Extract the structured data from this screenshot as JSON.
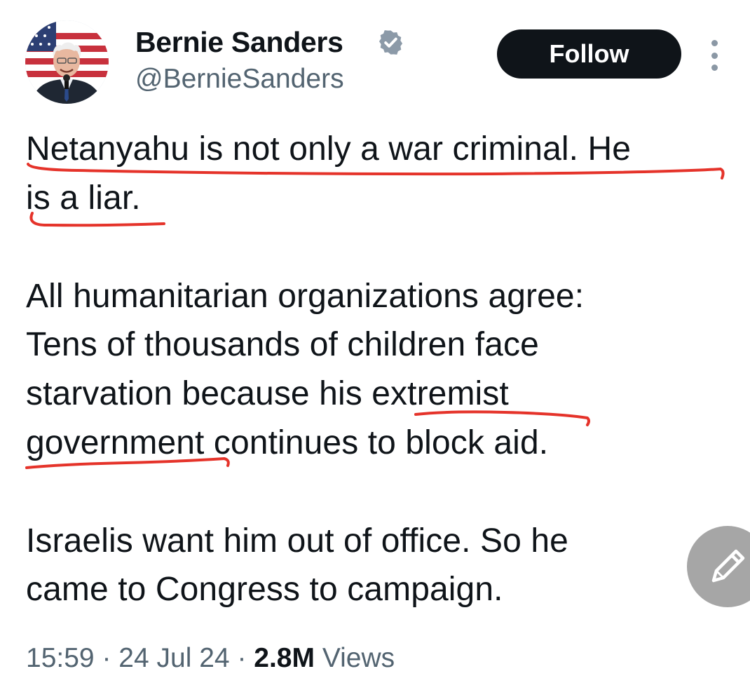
{
  "author": {
    "name": "Bernie Sanders",
    "handle": "@BernieSanders",
    "verified": true,
    "avatar_icon": "avatar-photo"
  },
  "actions": {
    "follow_label": "Follow",
    "more_icon": "more-vertical-icon",
    "compose_icon": "pencil-icon"
  },
  "tweet": {
    "lines": [
      "Netanyahu is not only a war criminal. He",
      "is a liar.",
      "All humanitarian organizations agree:",
      "Tens of thousands of children face",
      "starvation because his extremist",
      "government continues to block aid.",
      "Israelis want him out of office. So he",
      "came to Congress to campaign."
    ]
  },
  "meta": {
    "time": "15:59",
    "separator": "·",
    "date": "24 Jul 24",
    "views_count": "2.8M",
    "views_label": "Views"
  },
  "colors": {
    "text": "#0f1419",
    "secondary": "#536471",
    "verified_blue": "#1d9bf0",
    "annotation_red": "#e5332a",
    "fab_gray": "#a6a6a6"
  }
}
